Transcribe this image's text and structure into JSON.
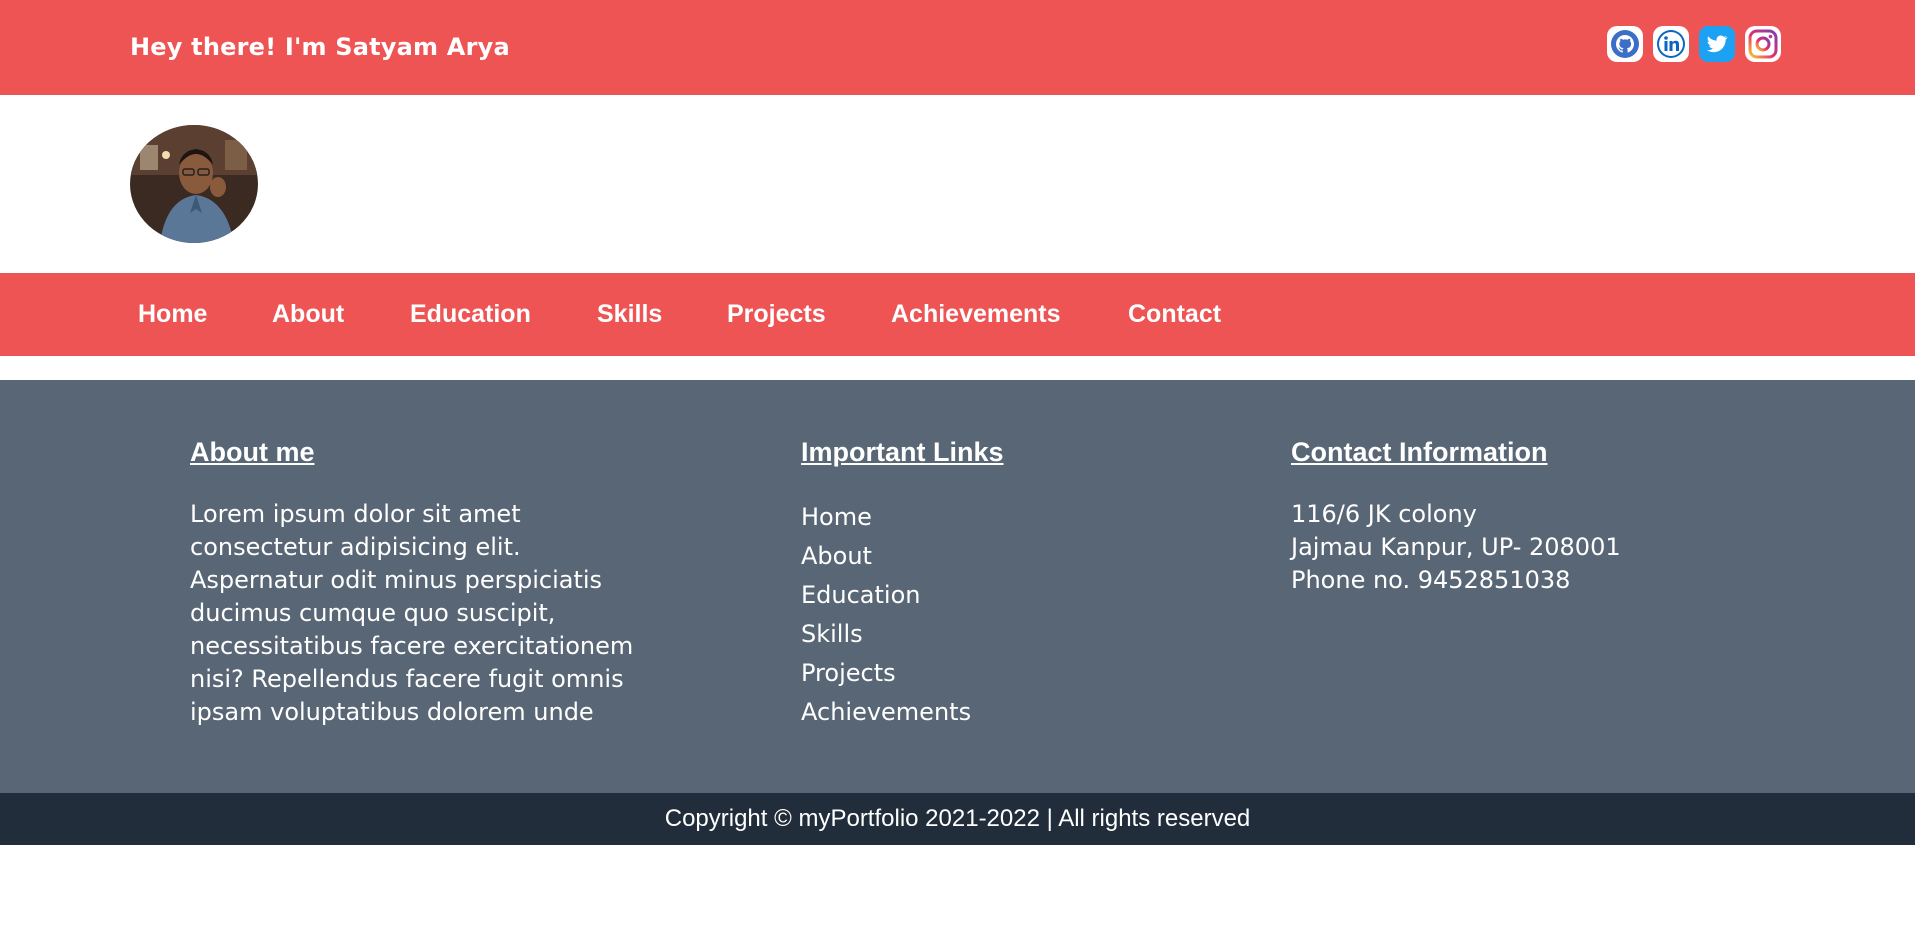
{
  "header": {
    "greeting": "Hey there! I'm Satyam Arya",
    "socials": [
      {
        "icon": "github-icon",
        "color": "#2f5ea8"
      },
      {
        "icon": "linkedin-icon",
        "color": "#0a66c2"
      },
      {
        "icon": "twitter-icon",
        "color": "#1da1f2"
      },
      {
        "icon": "instagram-icon",
        "color": "#c13584"
      }
    ]
  },
  "nav": {
    "items": [
      "Home",
      "About",
      "Education",
      "Skills",
      "Projects",
      "Achievements",
      "Contact"
    ]
  },
  "footer": {
    "about": {
      "title": "About me",
      "lines": [
        "Lorem ipsum dolor sit amet",
        "consectetur adipisicing elit.",
        "Aspernatur odit minus perspiciatis",
        "ducimus cumque quo suscipit,",
        "necessitatibus facere exercitationem",
        "nisi? Repellendus facere fugit omnis",
        "ipsam voluptatibus dolorem unde"
      ]
    },
    "links": {
      "title": "Important Links",
      "items": [
        "Home",
        "About",
        "Education",
        "Skills",
        "Projects",
        "Achievements"
      ]
    },
    "contact": {
      "title": "Contact Information",
      "lines": [
        "116/6 JK colony",
        "Jajmau Kanpur, UP- 208001",
        "Phone no. 9452851038"
      ]
    }
  },
  "copyright": "Copyright © myPortfolio 2021-2022 | All rights reserved",
  "colors": {
    "accent": "#ef5455",
    "footer_bg": "#596675",
    "copyright_bg": "#222d3b"
  }
}
